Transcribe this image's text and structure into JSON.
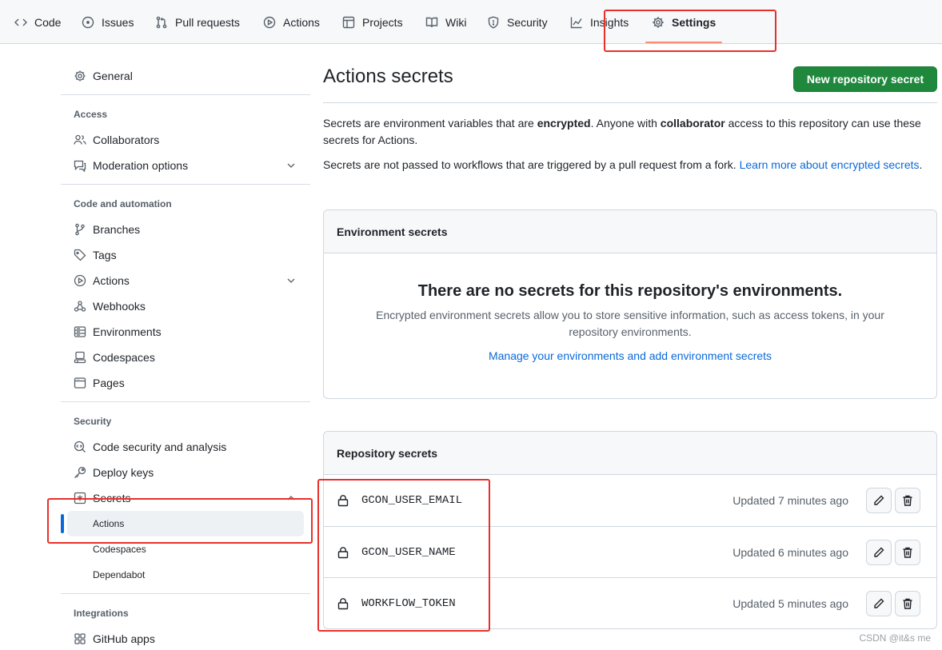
{
  "nav": {
    "tabs": [
      {
        "label": "Code",
        "icon": "code-icon"
      },
      {
        "label": "Issues",
        "icon": "issue-icon"
      },
      {
        "label": "Pull requests",
        "icon": "pull-request-icon"
      },
      {
        "label": "Actions",
        "icon": "play-icon"
      },
      {
        "label": "Projects",
        "icon": "table-icon"
      },
      {
        "label": "Wiki",
        "icon": "book-icon"
      },
      {
        "label": "Security",
        "icon": "shield-icon"
      },
      {
        "label": "Insights",
        "icon": "graph-icon"
      },
      {
        "label": "Settings",
        "icon": "gear-icon",
        "active": true
      }
    ]
  },
  "sidebar": {
    "general": "General",
    "access_heading": "Access",
    "collaborators": "Collaborators",
    "moderation": "Moderation options",
    "code_heading": "Code and automation",
    "branches": "Branches",
    "tags": "Tags",
    "actions": "Actions",
    "webhooks": "Webhooks",
    "environments": "Environments",
    "codespaces": "Codespaces",
    "pages": "Pages",
    "security_heading": "Security",
    "code_security": "Code security and analysis",
    "deploy_keys": "Deploy keys",
    "secrets": "Secrets",
    "secrets_sub": {
      "actions": "Actions",
      "codespaces": "Codespaces",
      "dependabot": "Dependabot"
    },
    "integrations_heading": "Integrations",
    "github_apps": "GitHub apps"
  },
  "main": {
    "title": "Actions secrets",
    "new_button": "New repository secret",
    "intro1": {
      "a": "Secrets are environment variables that are ",
      "b": "encrypted",
      "c": ". Anyone with ",
      "d": "collaborator",
      "e": " access to this repository can use these secrets for Actions."
    },
    "intro2": {
      "a": "Secrets are not passed to workflows that are triggered by a pull request from a fork. ",
      "link": "Learn more about encrypted secrets",
      "end": "."
    },
    "env": {
      "heading": "Environment secrets",
      "blank_title": "There are no secrets for this repository's environments.",
      "blank_text": "Encrypted environment secrets allow you to store sensitive information, such as access tokens, in your repository environments.",
      "link": "Manage your environments and add environment secrets"
    },
    "repo": {
      "heading": "Repository secrets",
      "secrets": [
        {
          "name": "GCON_USER_EMAIL",
          "updated": "Updated 7 minutes ago"
        },
        {
          "name": "GCON_USER_NAME",
          "updated": "Updated 6 minutes ago"
        },
        {
          "name": "WORKFLOW_TOKEN",
          "updated": "Updated 5 minutes ago"
        }
      ]
    }
  },
  "watermark": "CSDN @it&s me",
  "colors": {
    "primary_button": "#1f883d",
    "link": "#0969da",
    "annotation": "#e8302a",
    "active_tab_underline": "#fd8c73"
  }
}
